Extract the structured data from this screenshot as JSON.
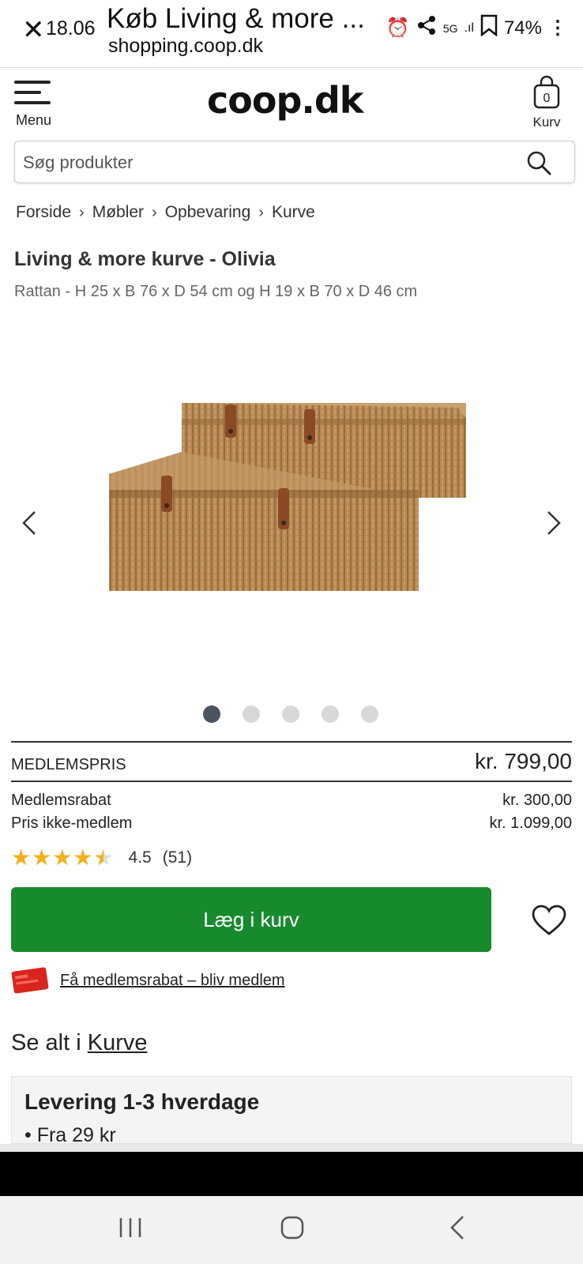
{
  "status_bar": {
    "time": "18.06",
    "tab_title": "Køb Living & more ...",
    "url": "shopping.coop.dk",
    "battery": "74%"
  },
  "header": {
    "menu_label": "Menu",
    "logo_text": "coop.dk",
    "cart_label": "Kurv",
    "cart_count": "0"
  },
  "search": {
    "placeholder": "Søg produkter"
  },
  "breadcrumb": [
    "Forside",
    "Møbler",
    "Opbevaring",
    "Kurve"
  ],
  "product": {
    "title": "Living & more kurve - Olivia",
    "subtitle": "Rattan - H 25 x B 76 x D 54 cm og H 19 x B 70 x D 46 cm",
    "image_count": 5,
    "active_image": 1
  },
  "price": {
    "member_label": "MEDLEMSPRIS",
    "member_price": "kr. 799,00",
    "discount_label": "Medlemsrabat",
    "discount_value": "kr. 300,00",
    "nonmember_label": "Pris ikke-medlem",
    "nonmember_value": "kr. 1.099,00"
  },
  "rating": {
    "value": "4.5",
    "count": "(51)",
    "fraction": 0.9
  },
  "actions": {
    "add_to_cart": "Læg i kurv",
    "member_link": "Få medlemsrabat – bliv medlem"
  },
  "see_all": {
    "prefix": "Se alt i",
    "link": "Kurve"
  },
  "delivery": {
    "title": "Levering 1-3 hverdage",
    "item": "Fra 29 kr"
  },
  "colors": {
    "primary_green": "#188a2e",
    "star_yellow": "#f2b01e",
    "card_red": "#d9261c"
  }
}
